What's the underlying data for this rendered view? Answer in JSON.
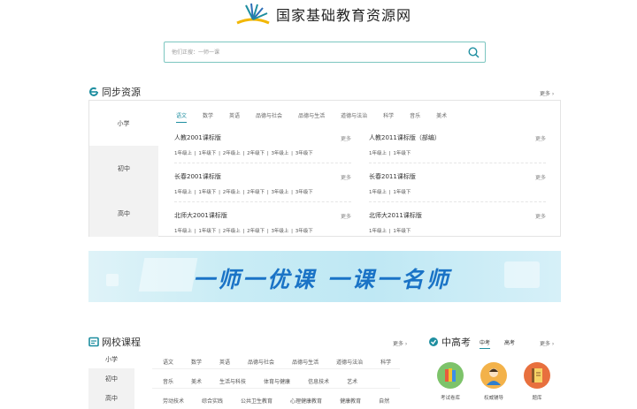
{
  "header": {
    "site_title": "国家基础教育资源网",
    "search_placeholder": "他们正搜：一师一课"
  },
  "sync": {
    "title": "同步资源",
    "more": "更多 ›",
    "levels": [
      "小学",
      "初中",
      "高中"
    ],
    "subjects": [
      "语文",
      "数学",
      "英语",
      "品德与社会",
      "品德与生活",
      "道德与法治",
      "科学",
      "音乐",
      "美术"
    ],
    "books": [
      {
        "title": "人教2001课标版",
        "more": "更多",
        "grades": [
          "1年级上",
          "1年级下",
          "2年级上",
          "2年级下",
          "3年级上",
          "3年级下"
        ]
      },
      {
        "title": "人教2011课标版（部编）",
        "more": "更多",
        "grades": [
          "1年级上",
          "1年级下"
        ]
      },
      {
        "title": "长春2001课标版",
        "more": "更多",
        "grades": [
          "1年级上",
          "1年级下",
          "2年级上",
          "2年级下",
          "3年级上",
          "3年级下"
        ]
      },
      {
        "title": "长春2011课标版",
        "more": "更多",
        "grades": [
          "1年级上",
          "1年级下"
        ]
      },
      {
        "title": "北师大2001课标版",
        "more": "更多",
        "grades": [
          "1年级上",
          "1年级下",
          "2年级上",
          "2年级下",
          "3年级上",
          "3年级下"
        ]
      },
      {
        "title": "北师大2011课标版",
        "more": "更多",
        "grades": [
          "1年级上",
          "1年级下"
        ]
      }
    ]
  },
  "banner": {
    "text": "一师一优课  一课一名师"
  },
  "school": {
    "title": "网校课程",
    "more": "更多 ›",
    "levels": [
      "小学",
      "初中",
      "高中"
    ],
    "row1": [
      "语文",
      "数学",
      "英语",
      "品德与社会",
      "品德与生活",
      "道德与法治",
      "科学"
    ],
    "row2": [
      "音乐",
      "美术",
      "生活与科技",
      "体育与健康",
      "信息技术",
      "艺术"
    ],
    "row3": [
      "劳动技术",
      "综合实践",
      "公共卫生教育",
      "心理健康教育",
      "健康教育",
      "自然"
    ]
  },
  "exam": {
    "title": "中高考",
    "tabs": [
      "中考",
      "高考"
    ],
    "more": "更多 ›",
    "items": [
      {
        "label": "考试卷库",
        "icon": "books-icon",
        "color": "#6ab04c"
      },
      {
        "label": "权威辅导",
        "icon": "teacher-icon",
        "color": "#e8a33c"
      },
      {
        "label": "题库",
        "icon": "notebook-icon",
        "color": "#e86a3c"
      }
    ]
  },
  "colors": {
    "accent": "#1e8ea0",
    "banner_text": "#1a73c6"
  }
}
